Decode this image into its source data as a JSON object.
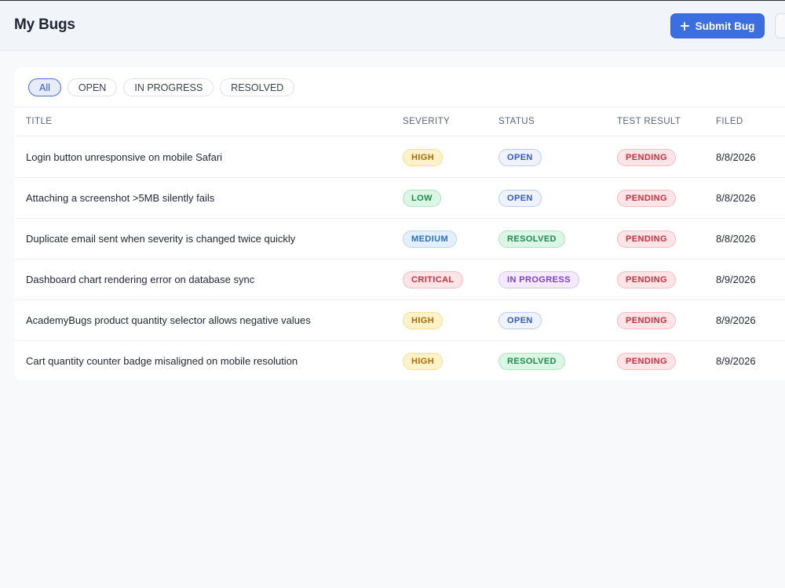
{
  "header": {
    "title": "My Bugs",
    "submit_label": "Submit Bug"
  },
  "filters": [
    "All",
    "OPEN",
    "IN PROGRESS",
    "RESOLVED"
  ],
  "active_filter": "All",
  "table": {
    "columns": [
      "TITLE",
      "SEVERITY",
      "STATUS",
      "TEST RESULT",
      "FILED"
    ],
    "rows": [
      {
        "title": "Login button unresponsive on mobile Safari",
        "severity": "HIGH",
        "status": "OPEN",
        "test_result": "PENDING",
        "filed": "8/8/2026"
      },
      {
        "title": "Attaching a screenshot >5MB silently fails",
        "severity": "LOW",
        "status": "OPEN",
        "test_result": "PENDING",
        "filed": "8/8/2026"
      },
      {
        "title": "Duplicate email sent when severity is changed twice quickly",
        "severity": "MEDIUM",
        "status": "RESOLVED",
        "test_result": "PENDING",
        "filed": "8/8/2026"
      },
      {
        "title": "Dashboard chart rendering error on database sync",
        "severity": "CRITICAL",
        "status": "IN PROGRESS",
        "test_result": "PENDING",
        "filed": "8/9/2026"
      },
      {
        "title": "AcademyBugs product quantity selector allows negative values",
        "severity": "HIGH",
        "status": "OPEN",
        "test_result": "PENDING",
        "filed": "8/9/2026"
      },
      {
        "title": "Cart quantity counter badge misaligned on mobile resolution",
        "severity": "HIGH",
        "status": "RESOLVED",
        "test_result": "PENDING",
        "filed": "8/9/2026"
      }
    ]
  },
  "colors": {
    "accent": "#3b6fe0",
    "severity": {
      "HIGH": "#b16a07",
      "LOW": "#1d8a4e",
      "MEDIUM": "#2c6fc2",
      "CRITICAL": "#c8303e"
    },
    "status": {
      "OPEN": "#3458c4",
      "RESOLVED": "#1d8a4e",
      "IN PROGRESS": "#7b3fd0"
    },
    "test_result": {
      "PENDING": "#c8303e"
    }
  },
  "icons": {
    "submit": "plus-icon"
  }
}
